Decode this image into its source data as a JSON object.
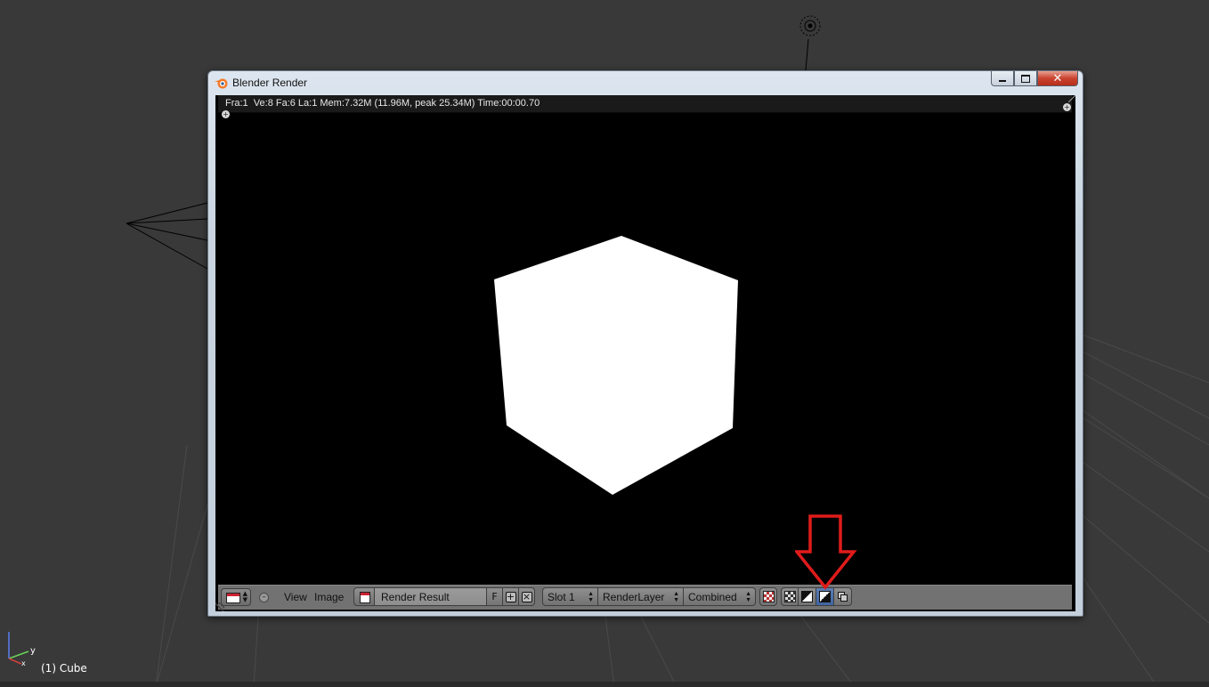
{
  "viewport": {
    "active_object_label": "(1) Cube",
    "axis_labels": {
      "y": "y",
      "x": "x"
    }
  },
  "window": {
    "title": "Blender Render",
    "controls": {
      "minimize": "minimize-icon",
      "maximize": "maximize-icon",
      "close": "close-icon"
    }
  },
  "render_info": {
    "text": "Fra:1  Ve:8 Fa:6 La:1 Mem:7.32M (11.96M, peak 25.34M) Time:00:00.70"
  },
  "image_editor_header": {
    "menus": [
      "View",
      "Image"
    ],
    "image_name": "Render Result",
    "fake_user_label": "F",
    "slot": "Slot 1",
    "render_layer": "RenderLayer",
    "render_pass": "Combined",
    "display_channels": [
      {
        "icon": "color-alpha-icon",
        "active": false
      },
      {
        "icon": "color-icon",
        "active": false
      },
      {
        "icon": "alpha-icon",
        "active": false
      },
      {
        "icon": "z-buffer-icon",
        "active": true
      },
      {
        "icon": "channels-icon",
        "active": false
      }
    ]
  },
  "colors": {
    "annotation_arrow": "#e01b1b",
    "active_button": "#4a6ea8",
    "viewport_bg": "#393939"
  }
}
